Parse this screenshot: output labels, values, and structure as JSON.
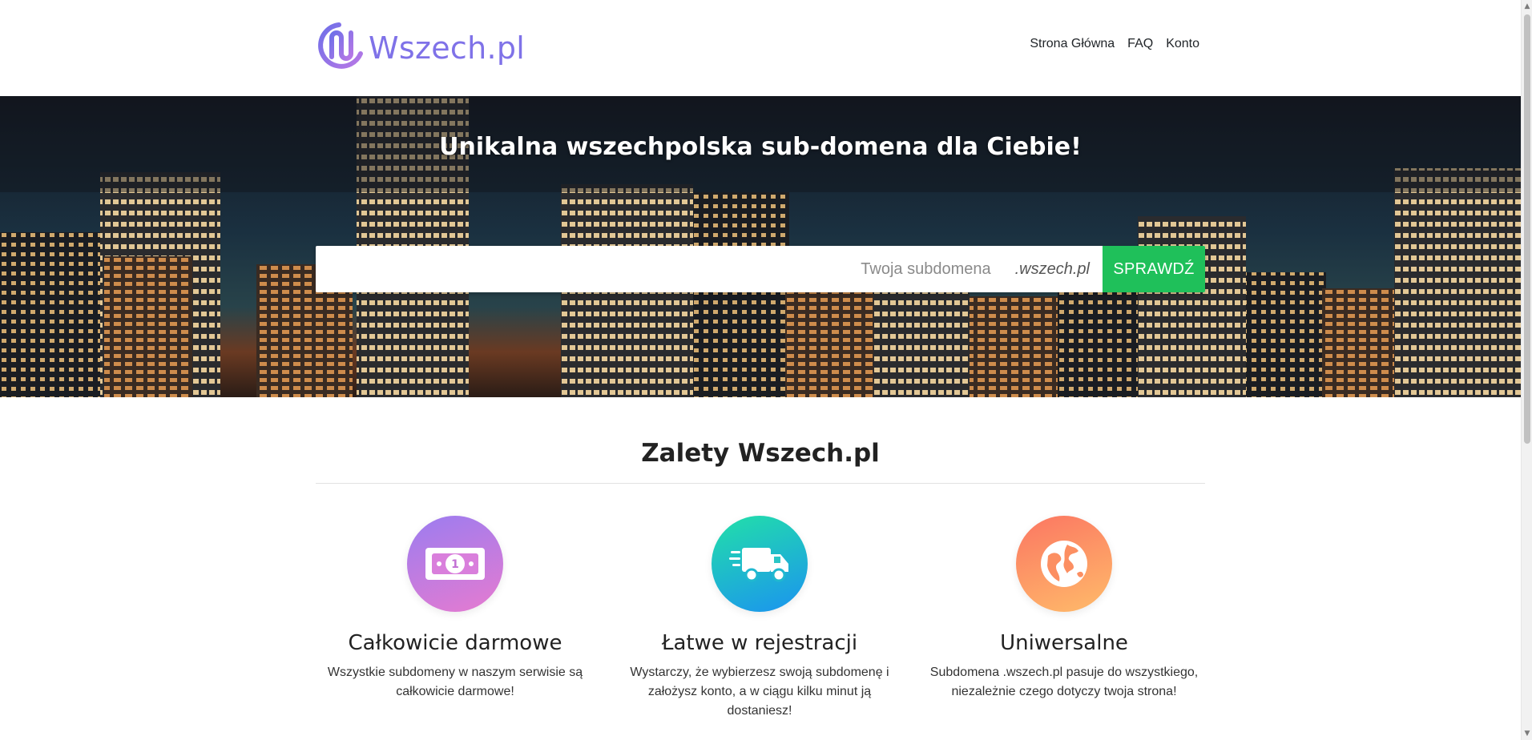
{
  "header": {
    "brand": "Wszech.pl",
    "nav": [
      {
        "label": "Strona Główna"
      },
      {
        "label": "FAQ"
      },
      {
        "label": "Konto"
      }
    ]
  },
  "hero": {
    "title": "Unikalna wszechpolska sub-domena dla Ciebie!",
    "search": {
      "placeholder": "Twoja subdomena",
      "value": "",
      "suffix": ".wszech.pl",
      "button_label": "SPRAWDŹ"
    }
  },
  "features": {
    "title": "Zalety Wszech.pl",
    "items": [
      {
        "icon": "money-bill-icon",
        "title": "Całkowicie darmowe",
        "text": "Wszystkie subdomeny w naszym serwisie są całkowicie darmowe!"
      },
      {
        "icon": "truck-icon",
        "title": "Łatwe w rejestracji",
        "text": "Wystarczy, że wybierzesz swoją subdomenę i założysz konto, a w ciągu kilku minut ją dostaniesz!"
      },
      {
        "icon": "globe-icon",
        "title": "Uniwersalne",
        "text": "Subdomena .wszech.pl pasuje do wszystkiego, niezależnie czego dotyczy twoja strona!"
      }
    ]
  },
  "colors": {
    "brand": "#7f72e8",
    "button": "#1fc05a"
  }
}
